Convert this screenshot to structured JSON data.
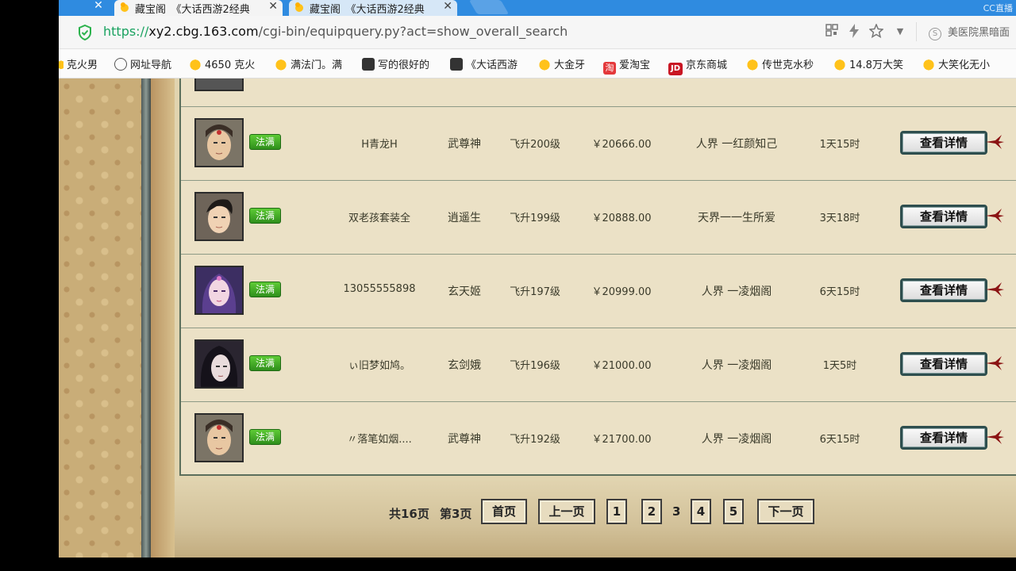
{
  "browser": {
    "tabs": [
      {
        "title": "藏宝阁_《大话西游2经典",
        "state": "active"
      },
      {
        "title": "藏宝阁_《大话西游2经典",
        "state": "inactive"
      }
    ],
    "brand": "CC直播",
    "address": {
      "scheme": "https://",
      "host": "xy2.cbg.163.com",
      "path": "/cgi-bin/equipquery.py?act=show_overall_search",
      "right_text": "美医院黑暗面"
    },
    "bookmarks": [
      {
        "label": "克火男",
        "icon": "duck-icon"
      },
      {
        "label": "网址导航",
        "icon": "globe-icon"
      },
      {
        "label": "4650 克火",
        "icon": "duck-icon"
      },
      {
        "label": "满法门。满",
        "icon": "duck-icon"
      },
      {
        "label": "写的很好的",
        "icon": "book-icon"
      },
      {
        "label": "《大话西游",
        "icon": "book-icon"
      },
      {
        "label": "大金牙",
        "icon": "duck-icon"
      },
      {
        "label": "爱淘宝",
        "icon": "taobao-icon",
        "glyph": "淘"
      },
      {
        "label": "京东商城",
        "icon": "jd-icon",
        "glyph": "JD"
      },
      {
        "label": "传世克水秒",
        "icon": "duck-icon"
      },
      {
        "label": "14.8万大笑",
        "icon": "duck-icon"
      },
      {
        "label": "大笑化无小",
        "icon": "duck-icon"
      }
    ]
  },
  "listing": {
    "rows": [
      {
        "badge": "法满",
        "name": "H青龙H",
        "school": "武尊神",
        "level": "飞升200级",
        "price": "￥20666.00",
        "server": "人界 一红颜知己",
        "time_left": "1天15时",
        "button": "查看详情",
        "avatar": "male-warrior"
      },
      {
        "badge": "法满",
        "name": "双老孩套装全",
        "school": "逍遥生",
        "level": "飞升199级",
        "price": "￥20888.00",
        "server": "天界一一生所爱",
        "time_left": "3天18时",
        "button": "查看详情",
        "avatar": "male-scholar"
      },
      {
        "badge": "法满",
        "name": "13055555898",
        "school": "玄天姬",
        "level": "飞升197级",
        "price": "￥20999.00",
        "server": "人界 一凌烟阁",
        "time_left": "6天15时",
        "button": "查看详情",
        "avatar": "female-purple"
      },
      {
        "badge": "法满",
        "name": "ぃ旧梦如鸠。",
        "school": "玄剑娥",
        "level": "飞升196级",
        "price": "￥21000.00",
        "server": "人界 一凌烟阁",
        "time_left": "1天5时",
        "button": "查看详情",
        "avatar": "female-dark"
      },
      {
        "badge": "法满",
        "name": "〃落笔如烟....",
        "school": "武尊神",
        "level": "飞升192级",
        "price": "￥21700.00",
        "server": "人界 一凌烟阁",
        "time_left": "6天15时",
        "button": "查看详情",
        "avatar": "male-warrior"
      }
    ]
  },
  "pagination": {
    "total": "共16页",
    "current_label": "第3页",
    "first": "首页",
    "prev": "上一页",
    "pages": [
      "1",
      "2",
      "3",
      "4",
      "5"
    ],
    "current": "3",
    "next": "下一页"
  }
}
